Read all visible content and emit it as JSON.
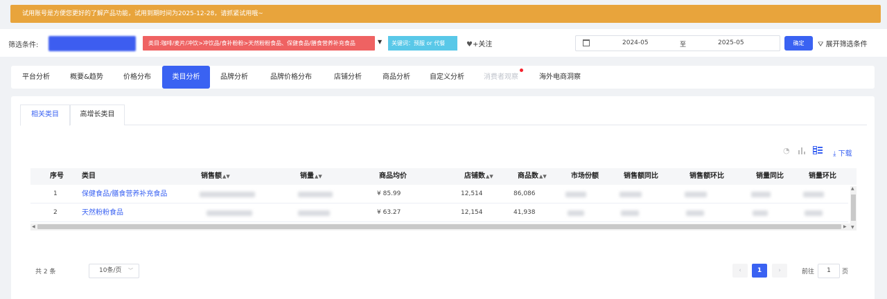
{
  "notice": "试用账号是方便您更好的了解产品功能，试用到期时间为2025-12-28，请抓紧试用哦~",
  "filter": {
    "label": "筛选条件:",
    "category_tag": "类目:咖啡/麦片/冲饮>冲饮品/食补粉粉>天然粉粉食品、保健食品/膳食营养补充食品",
    "keyword_tag": "关键词：预服 or 代餐",
    "follow": "+关注",
    "date_start": "2024-05",
    "date_sep": "至",
    "date_end": "2025-05",
    "confirm": "确定",
    "expand": "展开筛选条件"
  },
  "tabs": [
    "平台分析",
    "概要&趋势",
    "价格分布",
    "类目分析",
    "品牌分析",
    "品牌价格分布",
    "店铺分析",
    "商品分析",
    "自定义分析",
    "消费者观察",
    "海外电商洞察"
  ],
  "subtabs": [
    "相关类目",
    "高增长类目"
  ],
  "download": "下载",
  "table": {
    "headers": [
      "序号",
      "类目",
      "销售额",
      "销量",
      "商品均价",
      "店铺数",
      "商品数",
      "市场份额",
      "销售额同比",
      "销售额环比",
      "销量同比",
      "销量环比"
    ],
    "rows": [
      {
        "idx": "1",
        "category": "保健食品/膳食营养补充食品",
        "avg_price": "¥ 85.99",
        "shops": "12,514",
        "goods": "86,086"
      },
      {
        "idx": "2",
        "category": "天然粉粉食品",
        "avg_price": "¥ 63.27",
        "shops": "12,154",
        "goods": "41,938"
      }
    ]
  },
  "pagination": {
    "total": "共 2 条",
    "page_size": "10条/页",
    "prev": "‹",
    "current": "1",
    "next": "›",
    "goto_label": "前往",
    "goto_value": "1",
    "goto_suffix": "页"
  }
}
